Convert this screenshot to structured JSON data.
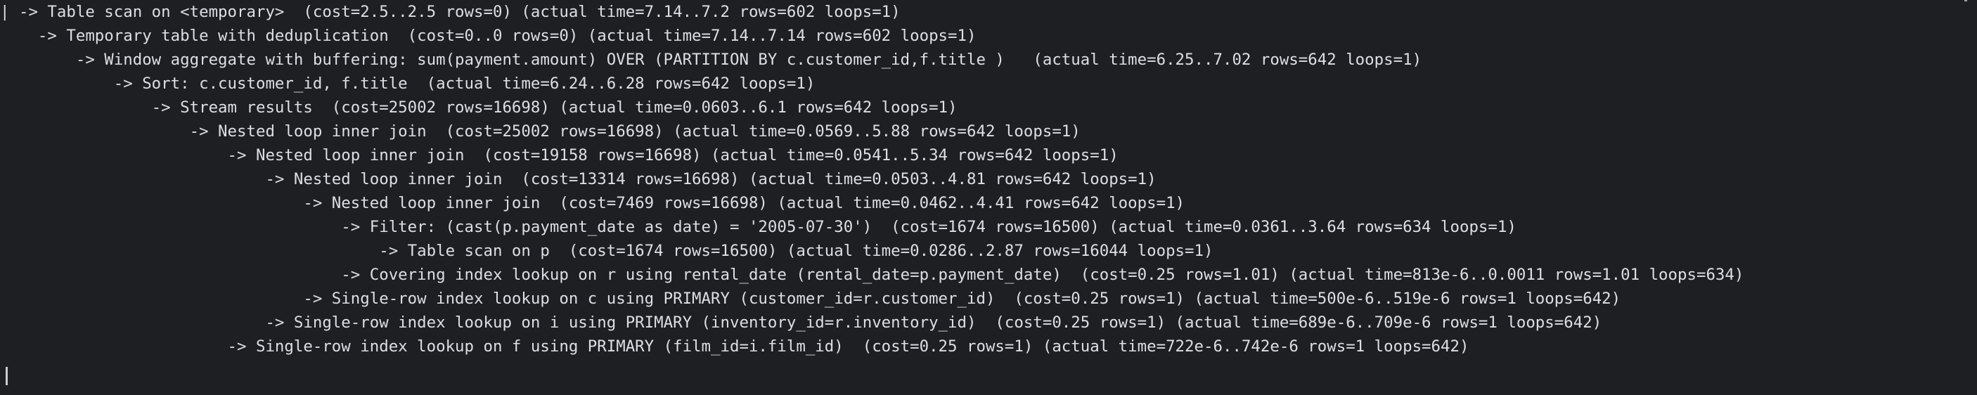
{
  "plan": {
    "lines": [
      "| -> Table scan on <temporary>  (cost=2.5..2.5 rows=0) (actual time=7.14..7.2 rows=602 loops=1)",
      "    -> Temporary table with deduplication  (cost=0..0 rows=0) (actual time=7.14..7.14 rows=602 loops=1)",
      "        -> Window aggregate with buffering: sum(payment.amount) OVER (PARTITION BY c.customer_id,f.title )   (actual time=6.25..7.02 rows=642 loops=1)",
      "            -> Sort: c.customer_id, f.title  (actual time=6.24..6.28 rows=642 loops=1)",
      "                -> Stream results  (cost=25002 rows=16698) (actual time=0.0603..6.1 rows=642 loops=1)",
      "                    -> Nested loop inner join  (cost=25002 rows=16698) (actual time=0.0569..5.88 rows=642 loops=1)",
      "                        -> Nested loop inner join  (cost=19158 rows=16698) (actual time=0.0541..5.34 rows=642 loops=1)",
      "                            -> Nested loop inner join  (cost=13314 rows=16698) (actual time=0.0503..4.81 rows=642 loops=1)",
      "                                -> Nested loop inner join  (cost=7469 rows=16698) (actual time=0.0462..4.41 rows=642 loops=1)",
      "                                    -> Filter: (cast(p.payment_date as date) = '2005-07-30')  (cost=1674 rows=16500) (actual time=0.0361..3.64 rows=634 loops=1)",
      "                                        -> Table scan on p  (cost=1674 rows=16500) (actual time=0.0286..2.87 rows=16044 loops=1)",
      "                                    -> Covering index lookup on r using rental_date (rental_date=p.payment_date)  (cost=0.25 rows=1.01) (actual time=813e-6..0.0011 rows=1.01 loops=634)",
      "                                -> Single-row index lookup on c using PRIMARY (customer_id=r.customer_id)  (cost=0.25 rows=1) (actual time=500e-6..519e-6 rows=1 loops=642)",
      "                            -> Single-row index lookup on i using PRIMARY (inventory_id=r.inventory_id)  (cost=0.25 rows=1) (actual time=689e-6..709e-6 rows=1 loops=642)",
      "                        -> Single-row index lookup on f using PRIMARY (film_id=i.film_id)  (cost=0.25 rows=1) (actual time=722e-6..742e-6 rows=1 loops=642)"
    ]
  },
  "colors": {
    "background": "#1e1f22",
    "text": "#dcdfe4"
  }
}
